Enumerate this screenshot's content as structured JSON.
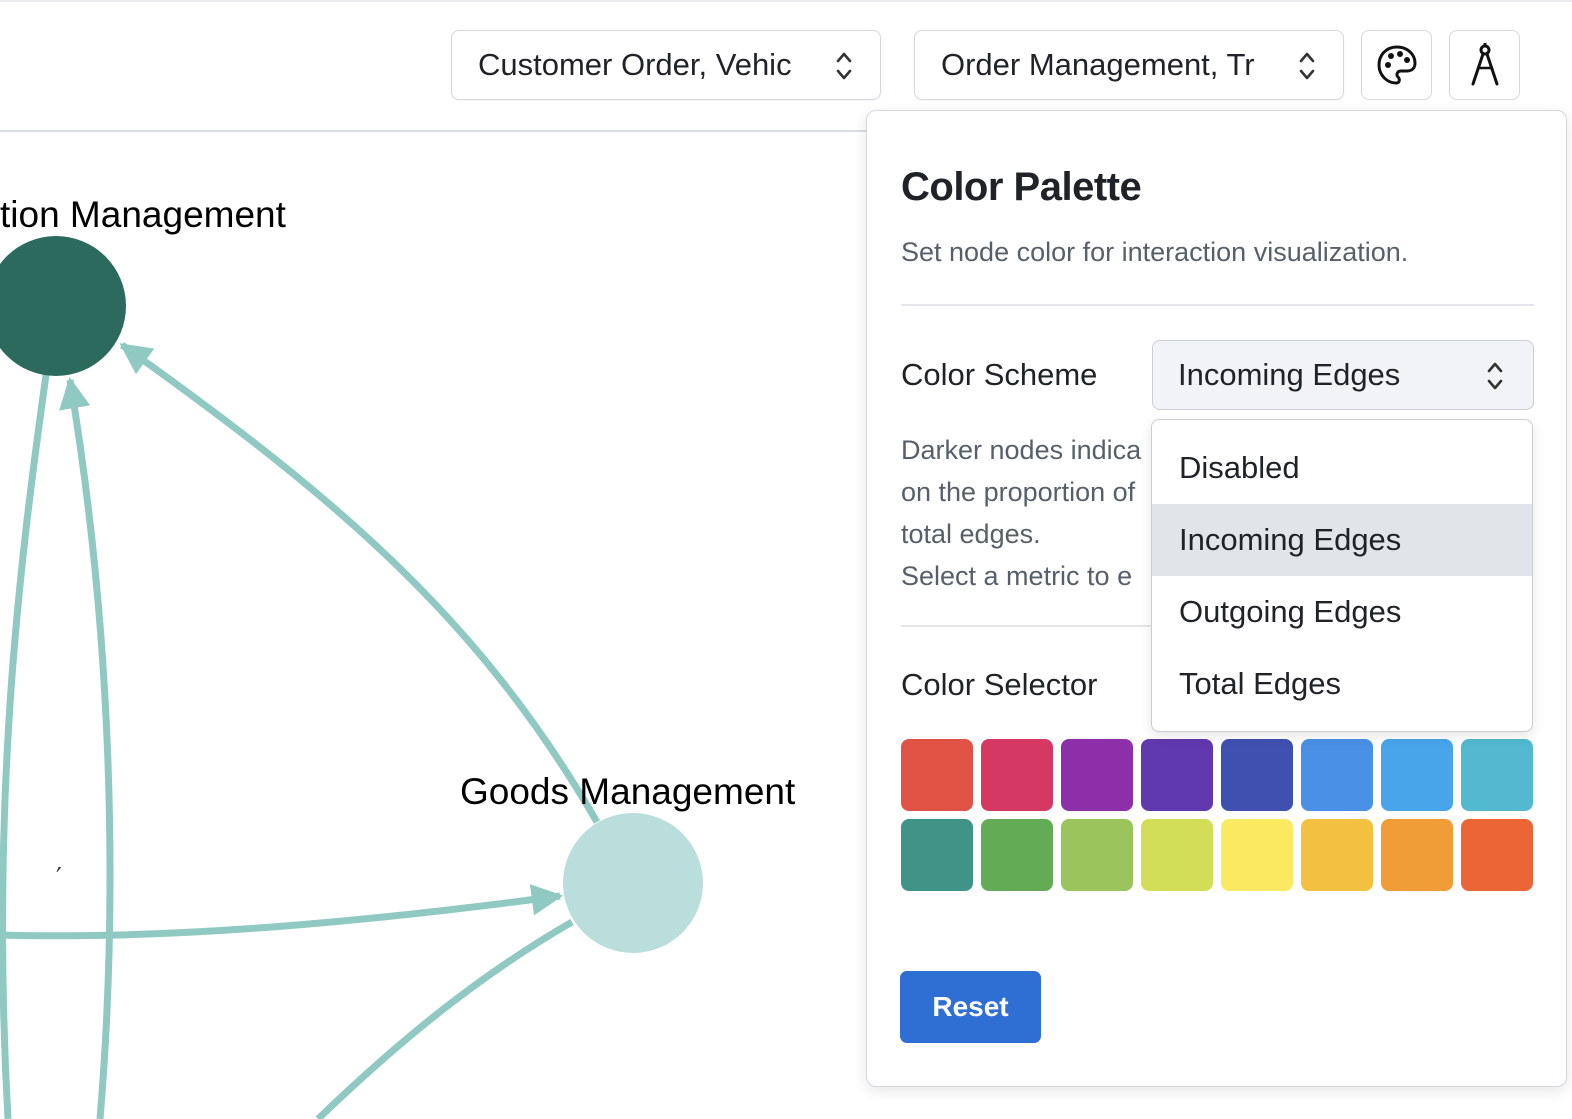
{
  "toolbar": {
    "source_select": {
      "value": "Customer Order, Vehic"
    },
    "target_select": {
      "value": "Order Management, Tr"
    },
    "palette_button": {
      "icon": "palette-icon"
    },
    "layout_button": {
      "icon": "compass-icon"
    }
  },
  "graph": {
    "nodes": [
      {
        "label": "tion Management",
        "color": "#2d6a5e"
      },
      {
        "label": "Goods Management",
        "color": "#b9dedb"
      }
    ],
    "edge_color": "#90c9c1",
    "stray_mark": "′"
  },
  "panel": {
    "title": "Color Palette",
    "description": "Set node color for interaction visualization.",
    "color_scheme": {
      "label": "Color Scheme",
      "value": "Incoming Edges",
      "options": [
        "Disabled",
        "Incoming Edges",
        "Outgoing Edges",
        "Total Edges"
      ],
      "selected": "Incoming Edges"
    },
    "help_lines": [
      "Darker nodes indica",
      "on the proportion of",
      "total edges.",
      "Select a metric to e"
    ],
    "color_selector": {
      "label": "Color Selector",
      "colors": [
        "#e05344",
        "#d63864",
        "#8e2faa",
        "#6039ae",
        "#4050b0",
        "#4a90e6",
        "#48a5ea",
        "#52b9d0",
        "#409487",
        "#63ac55",
        "#9bc45d",
        "#d2dd58",
        "#fbe961",
        "#f3c040",
        "#f09c37",
        "#eb6536"
      ]
    },
    "reset_label": "Reset"
  }
}
